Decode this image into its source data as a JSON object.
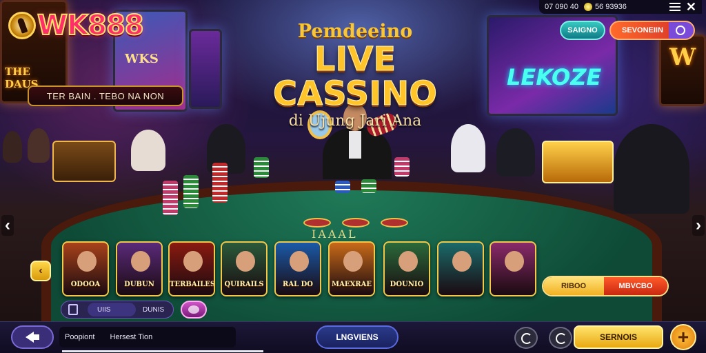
{
  "brand": {
    "logo_text": "WK888"
  },
  "hero": {
    "pre_title": "Pemdeeino",
    "title": "LIVE CASSINO",
    "tagline": "di Ujung Jari Ana"
  },
  "top_banner": {
    "label": "TER BAIN . TEBO NA NON"
  },
  "status_bar": {
    "time": "07 090 40",
    "balance": "56 93936"
  },
  "header_buttons": {
    "signin_label": "SAIGNO",
    "register_label": "SEVONEIIN"
  },
  "background_screens": {
    "left_neon": "THE DAUS",
    "left_tv": "WKS",
    "right_tv": "LEKOZE",
    "right_neon": "W"
  },
  "table": {
    "text": "IAAAL"
  },
  "game_strip": {
    "nav_label": "‹",
    "tiles": [
      {
        "label": "ODOOA",
        "color": "#a8421a"
      },
      {
        "label": "DUBUN",
        "color": "#5a2a7a"
      },
      {
        "label": "TERBAILES",
        "color": "#8a1a10"
      },
      {
        "label": "QUIRAILS",
        "color": "#2a5a3a"
      },
      {
        "label": "RAL DO",
        "color": "#1a5aa8"
      },
      {
        "label": "MAEXRAE",
        "color": "#c86a18"
      },
      {
        "label": "DOUNIO",
        "color": "#2a6a3a"
      },
      {
        "label": "",
        "color": "#1a6a6a"
      },
      {
        "label": "",
        "color": "#8a2a6a"
      }
    ]
  },
  "filters": {
    "option_1": "UIIS",
    "option_2": "DUNIS"
  },
  "bet_buttons": {
    "left": "RIBOO",
    "right": "MBVCBO"
  },
  "bottom_bar": {
    "info_left": "Poopiont",
    "info_right": "Hersest Tion",
    "lobby_label": "LNGVIENS",
    "deposit_label": "SERNOIS",
    "plus_label": "+"
  },
  "nav_arrows": {
    "left": "‹",
    "right": "›"
  },
  "colors": {
    "accent_gold": "#ffc42a",
    "felt_green": "#1f7a58",
    "brand_pink": "#ff2e6a"
  }
}
